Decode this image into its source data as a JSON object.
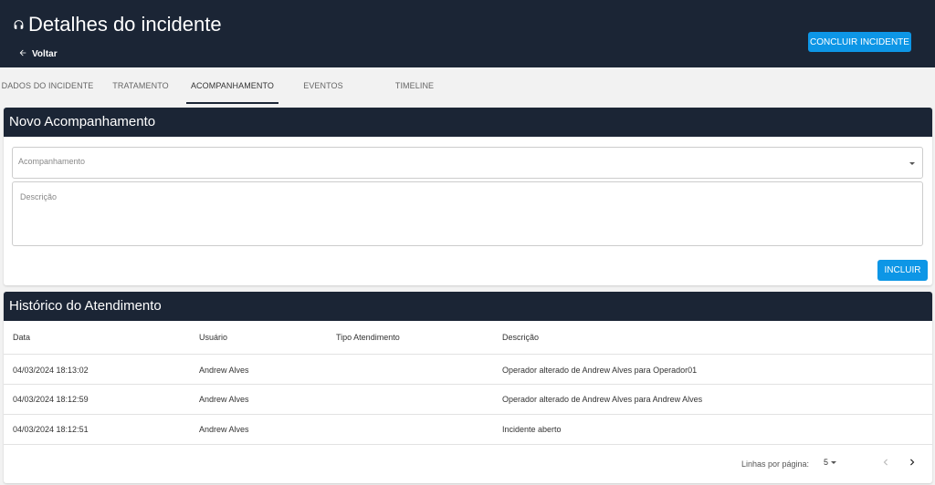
{
  "header": {
    "title": "Detalhes do incidente",
    "back_label": "Voltar",
    "conclude_label": "CONCLUIR INCIDENTE"
  },
  "tabs": [
    {
      "label": "DADOS DO INCIDENTE",
      "active": false
    },
    {
      "label": "TRATAMENTO",
      "active": false
    },
    {
      "label": "ACOMPANHAMENTO",
      "active": true
    },
    {
      "label": "EVENTOS",
      "active": false
    },
    {
      "label": "TIMELINE",
      "active": false
    }
  ],
  "novo": {
    "title": "Novo Acompanhamento",
    "select_placeholder": "Acompanhamento",
    "description_placeholder": "Descrição",
    "include_label": "INCLUIR"
  },
  "historico": {
    "title": "Histórico do Atendimento",
    "columns": [
      "Data",
      "Usuário",
      "Tipo Atendimento",
      "Descrição"
    ],
    "rows": [
      {
        "data": "04/03/2024 18:13:02",
        "usuario": "Andrew Alves",
        "tipo": "",
        "descricao": "Operador alterado de Andrew Alves para Operador01"
      },
      {
        "data": "04/03/2024 18:12:59",
        "usuario": "Andrew Alves",
        "tipo": "",
        "descricao": "Operador alterado de Andrew Alves para Andrew Alves"
      },
      {
        "data": "04/03/2024 18:12:51",
        "usuario": "Andrew Alves",
        "tipo": "",
        "descricao": "Incidente aberto"
      }
    ],
    "pagination": {
      "rows_per_page_label": "Linhas por página:",
      "rows_per_page": "5"
    }
  },
  "colors": {
    "header_bg": "#1b2535",
    "accent": "#0d96e6"
  }
}
